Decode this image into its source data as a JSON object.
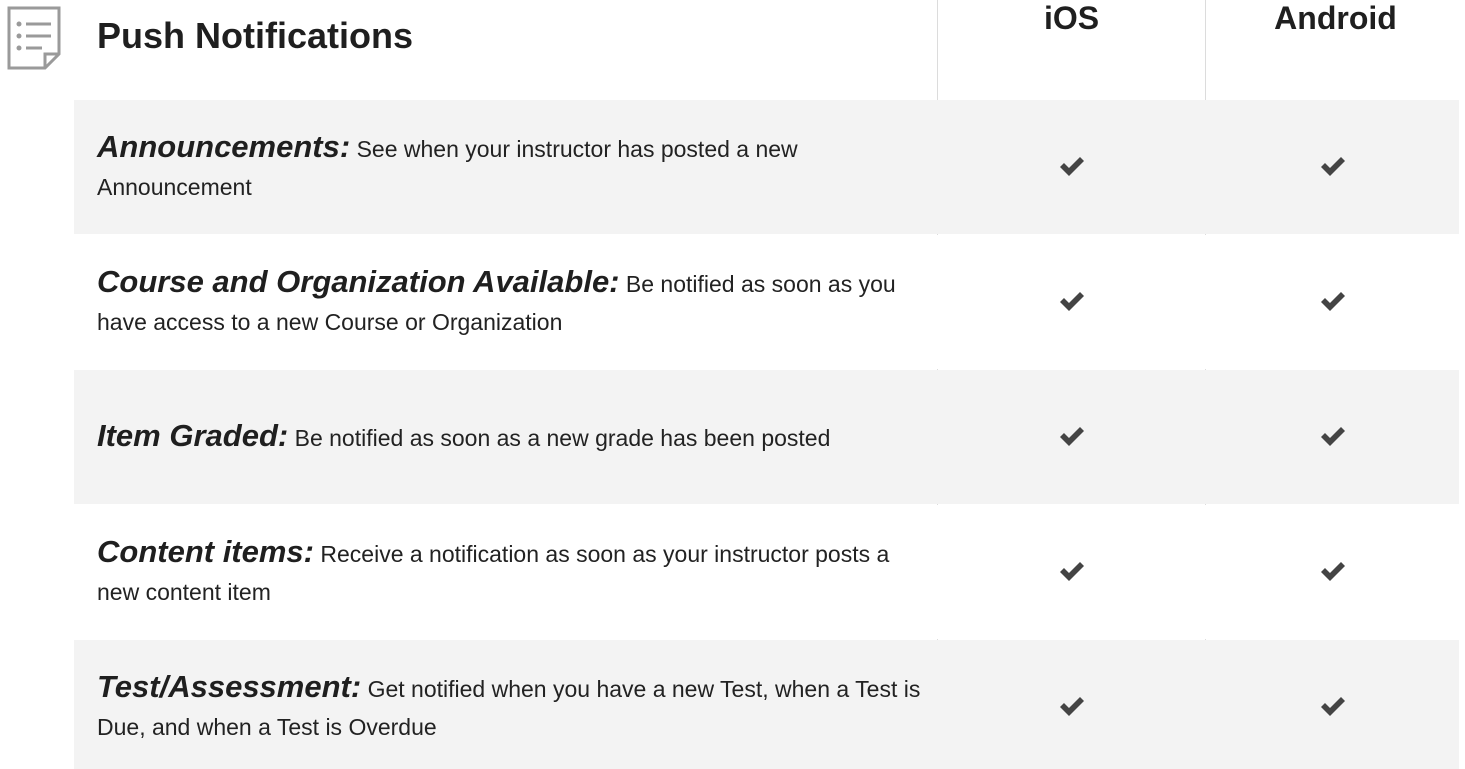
{
  "header": {
    "title": "Push Notifications",
    "icon": "list-document-icon",
    "columns": [
      "iOS",
      "Android"
    ]
  },
  "rows": [
    {
      "feature": "Announcements:",
      "description": " See when your instructor has posted a new Announcement",
      "ios": true,
      "android": true
    },
    {
      "feature": "Course and Organization Available:",
      "description": " Be notified as soon as you have access to a new Course or Organization",
      "ios": true,
      "android": true
    },
    {
      "feature": "Item Graded:",
      "description": " Be notified as soon as a new grade has been posted",
      "ios": true,
      "android": true
    },
    {
      "feature": "Content items:",
      "description": " Receive a notification as soon as your instructor posts a new content item",
      "ios": true,
      "android": true
    },
    {
      "feature": "Test/Assessment:",
      "description": " Get notified when you have a new Test, when a Test is Due, and when a Test is Overdue",
      "ios": true,
      "android": true
    }
  ],
  "colors": {
    "shaded_row": "#f3f3f3",
    "check": "#444444",
    "icon": "#9a9a9a"
  }
}
